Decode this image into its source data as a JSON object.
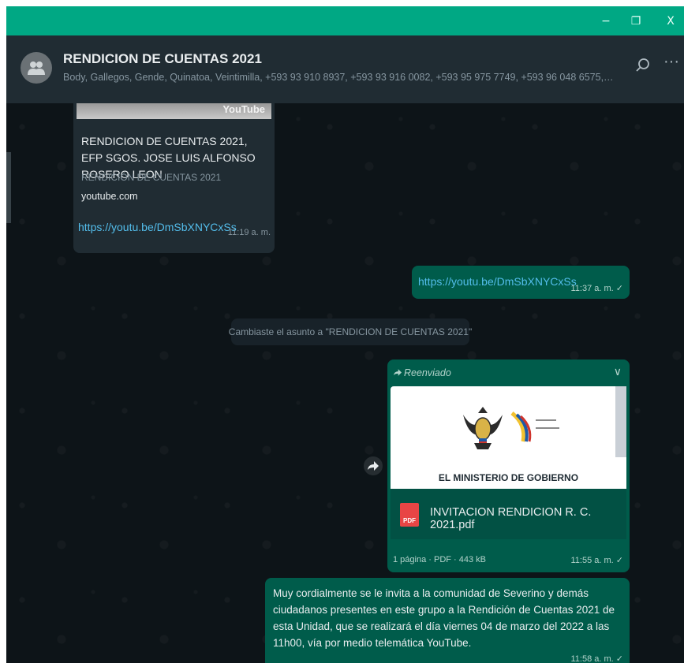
{
  "window": {
    "minimize_icon": "−",
    "restore_icon": "❐",
    "close_icon": "X"
  },
  "header": {
    "group_name": "RENDICION DE CUENTAS 2021",
    "members": "Body, Gallegos, Gende, Quinatoa, Veintimilla, +593 93 910 8937, +593 93 916 0082, +593 95 975 7749, +593 96 048 6575, +593 96 0...",
    "menu_icon": "···"
  },
  "messages": {
    "link_preview": {
      "watermark": "YouTube",
      "title": "RENDICION DE CUENTAS 2021, EFP SGOS. JOSE LUIS ALFONSO ROSERO LEON",
      "description": "RENDICIÓN DE CUENTAS 2021",
      "domain": "youtube.com",
      "link": "https://youtu.be/DmSbXNYCxSs",
      "time": "11:19 a. m."
    },
    "sent_link": {
      "link": "https://youtu.be/DmSbXNYCxSs",
      "time": "11:37 a. m. ✓"
    },
    "system": {
      "text": "Cambiaste el asunto a \"RENDICION DE CUENTAS 2021\""
    },
    "document": {
      "forwarded_label": "Reenviado",
      "chevron": "∨",
      "preview_caption": "EL MINISTERIO DE GOBIERNO",
      "pdf_badge": "PDF",
      "file_name": "INVITACION RENDICION R. C. 2021.pdf",
      "file_meta": "1 página · PDF · 443 kB",
      "time": "11:55 a. m. ✓"
    },
    "invitation": {
      "text": "Muy cordialmente se le invita a la comunidad de Severino y demás ciudadanos presentes en este grupo a la Rendición de Cuentas 2021 de esta Unidad, que se realizará el día viernes 04 de marzo del 2022 a las 11h00, vía por medio telemática YouTube.",
      "time": "11:58 a. m. ✓"
    }
  },
  "colors": {
    "titlebar": "#00a884",
    "header": "#202c33",
    "background": "#0d1418",
    "bubble_in": "#202c33",
    "bubble_out": "#005c4b",
    "link": "#53bdeb"
  }
}
